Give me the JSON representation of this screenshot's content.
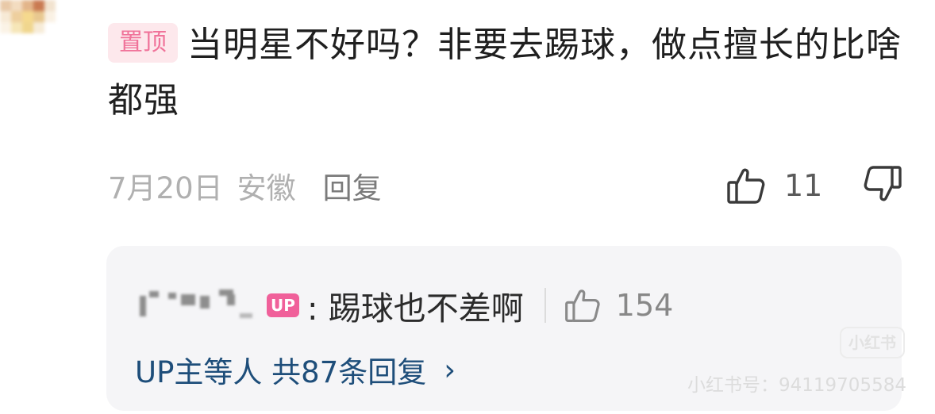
{
  "comment": {
    "pin_badge": "置顶",
    "text": "当明星不好吗？非要去踢球，做点擅长的比啥都强",
    "date": "7月20日",
    "location": "安徽",
    "reply_label": "回复",
    "like_count": "11"
  },
  "reply": {
    "up_badge": "UP",
    "text": ": 踢球也不差啊",
    "like_count": "154",
    "more_label": "UP主等人 共87条回复",
    "more_chevron": "›"
  },
  "watermark": {
    "logo": "小红书",
    "id_text": "小红书号：94119705584"
  },
  "icons": {
    "like": "thumbs-up-icon",
    "dislike": "thumbs-down-icon",
    "reply_like": "thumbs-up-icon",
    "chevron": "chevron-right-icon"
  },
  "colors": {
    "pin_badge_bg": "#fde8ec",
    "pin_badge_text": "#f0739a",
    "up_badge_bg": "#f0609a",
    "link_blue": "#1e4e7a",
    "reply_box_bg": "#f5f5f7"
  }
}
